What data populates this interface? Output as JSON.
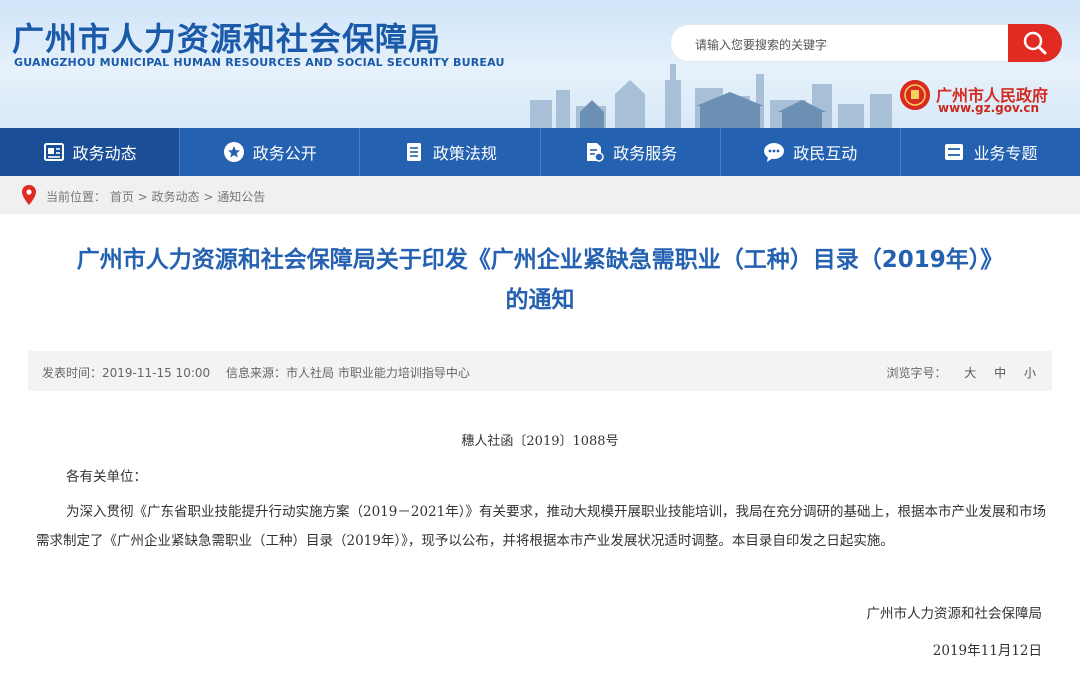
{
  "header": {
    "title": "广州市人力资源和社会保障局",
    "subtitle": "GUANGZHOU MUNICIPAL HUMAN RESOURCES AND SOCIAL SECURITY BUREAU",
    "search_placeholder": "请输入您要搜索的关键字",
    "gov_name": "广州市人民政府",
    "gov_url": "www.gz.gov.cn"
  },
  "nav": {
    "items": [
      {
        "label": "政务动态",
        "icon": "news-icon"
      },
      {
        "label": "政务公开",
        "icon": "star-circle-icon"
      },
      {
        "label": "政策法规",
        "icon": "document-icon"
      },
      {
        "label": "政务服务",
        "icon": "service-doc-icon"
      },
      {
        "label": "政民互动",
        "icon": "chat-bubble-icon"
      },
      {
        "label": "业务专题",
        "icon": "list-icon"
      }
    ]
  },
  "breadcrumb": {
    "prefix": "当前位置：",
    "items": [
      "首页",
      "政务动态",
      "通知公告"
    ],
    "sep": " > "
  },
  "article": {
    "title_line1": "广州市人力资源和社会保障局关于印发《广州企业紧缺急需职业（工种）目录（2019年）》",
    "title_line2": "的通知",
    "publish_time": "发表时间：2019-11-15 10:00",
    "source": "信息来源：市人社局 市职业能力培训指导中心",
    "font_size_label": "浏览字号：",
    "font_sizes": [
      "大",
      "中",
      "小"
    ],
    "doc_number": "穗人社函〔2019〕1088号",
    "salutation": "各有关单位：",
    "body": "为深入贯彻《广东省职业技能提升行动实施方案（2019－2021年）》有关要求，推动大规模开展职业技能培训，我局在充分调研的基础上，根据本市产业发展和市场需求制定了《广州企业紧缺急需职业（工种）目录（2019年）》，现予以公布，并将根据本市产业发展状况适时调整。本目录自印发之日起实施。",
    "signature": "广州市人力资源和社会保障局",
    "date": "2019年11月12日"
  },
  "colors": {
    "brand_blue": "#2461b1",
    "nav_active": "#1a4f98",
    "search_red": "#e12a22",
    "gov_red": "#d42b22"
  }
}
